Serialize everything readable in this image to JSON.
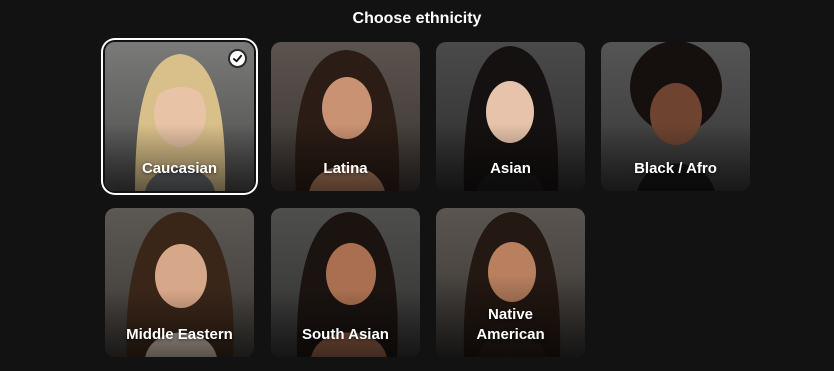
{
  "title": "Choose ethnicity",
  "options": [
    {
      "label": "Caucasian",
      "selected": true
    },
    {
      "label": "Latina",
      "selected": false
    },
    {
      "label": "Asian",
      "selected": false
    },
    {
      "label": "Black / Afro",
      "selected": false
    },
    {
      "label": "Middle Eastern",
      "selected": false
    },
    {
      "label": "South Asian",
      "selected": false
    },
    {
      "label": "Native American",
      "selected": false
    }
  ],
  "colors": {
    "background": "#121212",
    "text": "#ffffff",
    "selected_border": "#ffffff"
  },
  "icons": {
    "selected": "check-circle-icon"
  }
}
